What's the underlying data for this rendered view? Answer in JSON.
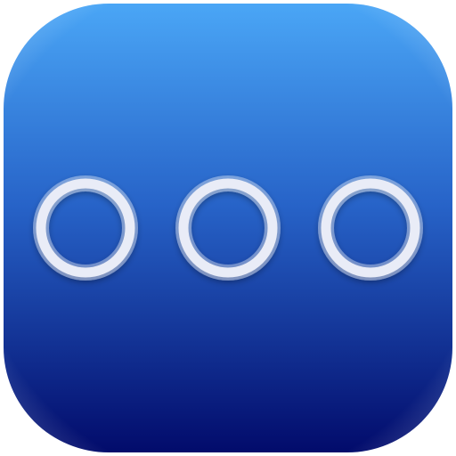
{
  "app_icon": {
    "icon": "more-dots-icon",
    "dot_count": 3,
    "colors": {
      "gradient_top": "#4aa6f6",
      "gradient_mid": "#2763c8",
      "gradient_bottom": "#020b6b",
      "ring": "#e9ecf7",
      "ring_glow": "#ffffff"
    }
  }
}
